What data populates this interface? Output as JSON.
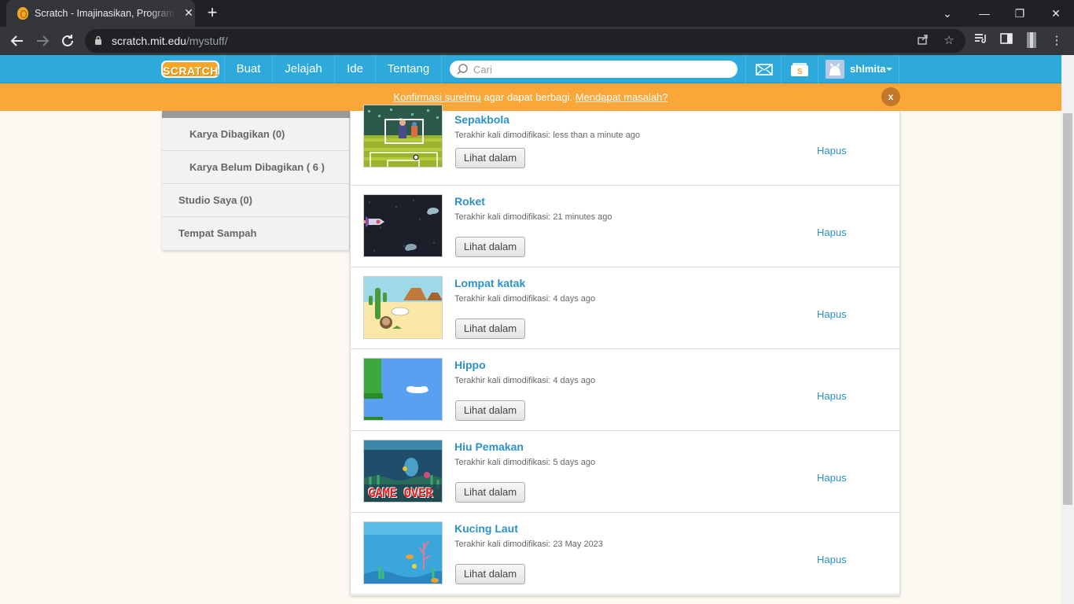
{
  "browser": {
    "tab_title": "Scratch - Imajinasikan, Program",
    "tab_close": "✕",
    "new_tab": "+",
    "url_host": "scratch.mit.edu",
    "url_path": "/mystuff/",
    "window_controls": {
      "minimize": "⌄",
      "restore": "—",
      "maximize": "❐",
      "close": "✕"
    }
  },
  "nav": {
    "logo": "SCRATCH",
    "links": [
      "Buat",
      "Jelajah",
      "Ide",
      "Tentang"
    ],
    "search_placeholder": "Cari",
    "username": "shlmita"
  },
  "banner": {
    "link1": "Konfirmasi surelmu",
    "middle": " agar dapat berbagi. ",
    "link2": "Mendapat masalah?",
    "close": "x"
  },
  "sidebar": {
    "items": [
      "Karya Dibagikan (0)",
      "Karya Belum Dibagikan ( 6 )",
      "Studio Saya (0)",
      "Tempat Sampah"
    ]
  },
  "projects": [
    {
      "title": "Sepakbola",
      "meta": "Terakhir kali dimodifikasi: less than a minute ago",
      "button": "Lihat dalam",
      "delete": "Hapus"
    },
    {
      "title": "Roket",
      "meta": "Terakhir kali dimodifikasi: 21 minutes ago",
      "button": "Lihat dalam",
      "delete": "Hapus"
    },
    {
      "title": "Lompat katak",
      "meta": "Terakhir kali dimodifikasi: 4 days ago",
      "button": "Lihat dalam",
      "delete": "Hapus"
    },
    {
      "title": "Hippo",
      "meta": "Terakhir kali dimodifikasi: 4 days ago",
      "button": "Lihat dalam",
      "delete": "Hapus"
    },
    {
      "title": "Hiu Pemakan",
      "meta": "Terakhir kali dimodifikasi: 5 days ago",
      "button": "Lihat dalam",
      "delete": "Hapus"
    },
    {
      "title": "Kucing Laut",
      "meta": "Terakhir kali dimodifikasi: 23 May 2023",
      "button": "Lihat dalam",
      "delete": "Hapus"
    }
  ],
  "thumb_texts": {
    "game_over": "GAME OVER"
  },
  "colors": {
    "nav": "#2da9dc",
    "banner": "#f9a739",
    "link": "#2a92c9"
  }
}
